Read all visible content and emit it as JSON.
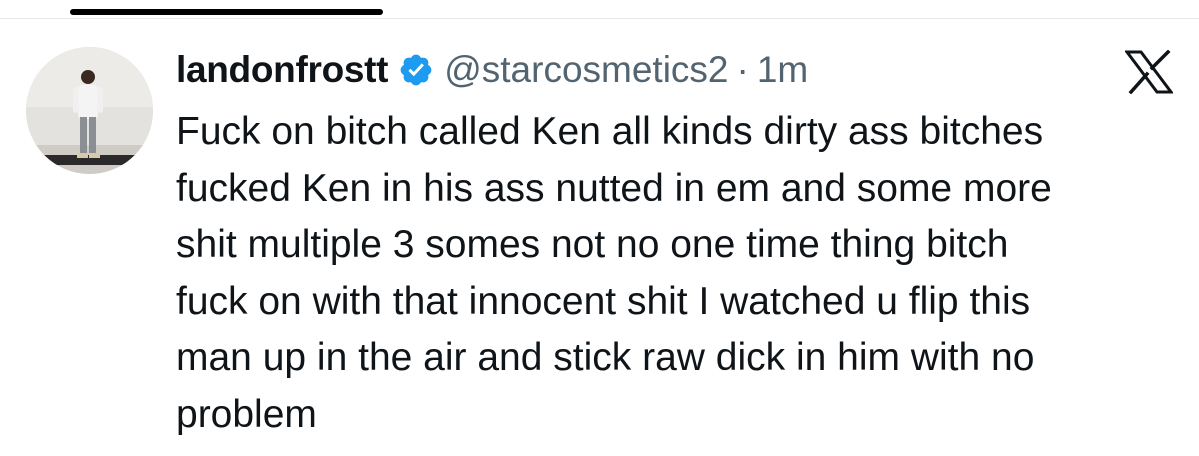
{
  "author": {
    "display_name": "landonfrostt",
    "handle": "@starcosmetics2",
    "separator": "·",
    "time": "1m",
    "verified_icon": "verified-badge-icon",
    "avatar": "profile photo"
  },
  "brand": {
    "icon": "x-logo-icon"
  },
  "tweet": {
    "lines": [
      "Fuck on bitch called Ken all kinds dirty ass bitches",
      "fucked Ken in his ass nutted in em and some more",
      "shit multiple 3 somes not no one time thing bitch",
      "fuck on with that innocent shit I watched u flip this",
      "man up in the air and stick raw dick in him with no",
      "problem"
    ]
  },
  "colors": {
    "text": "#0f1419",
    "secondary": "#536471",
    "verified": "#1d9bf0",
    "background": "#ffffff"
  }
}
